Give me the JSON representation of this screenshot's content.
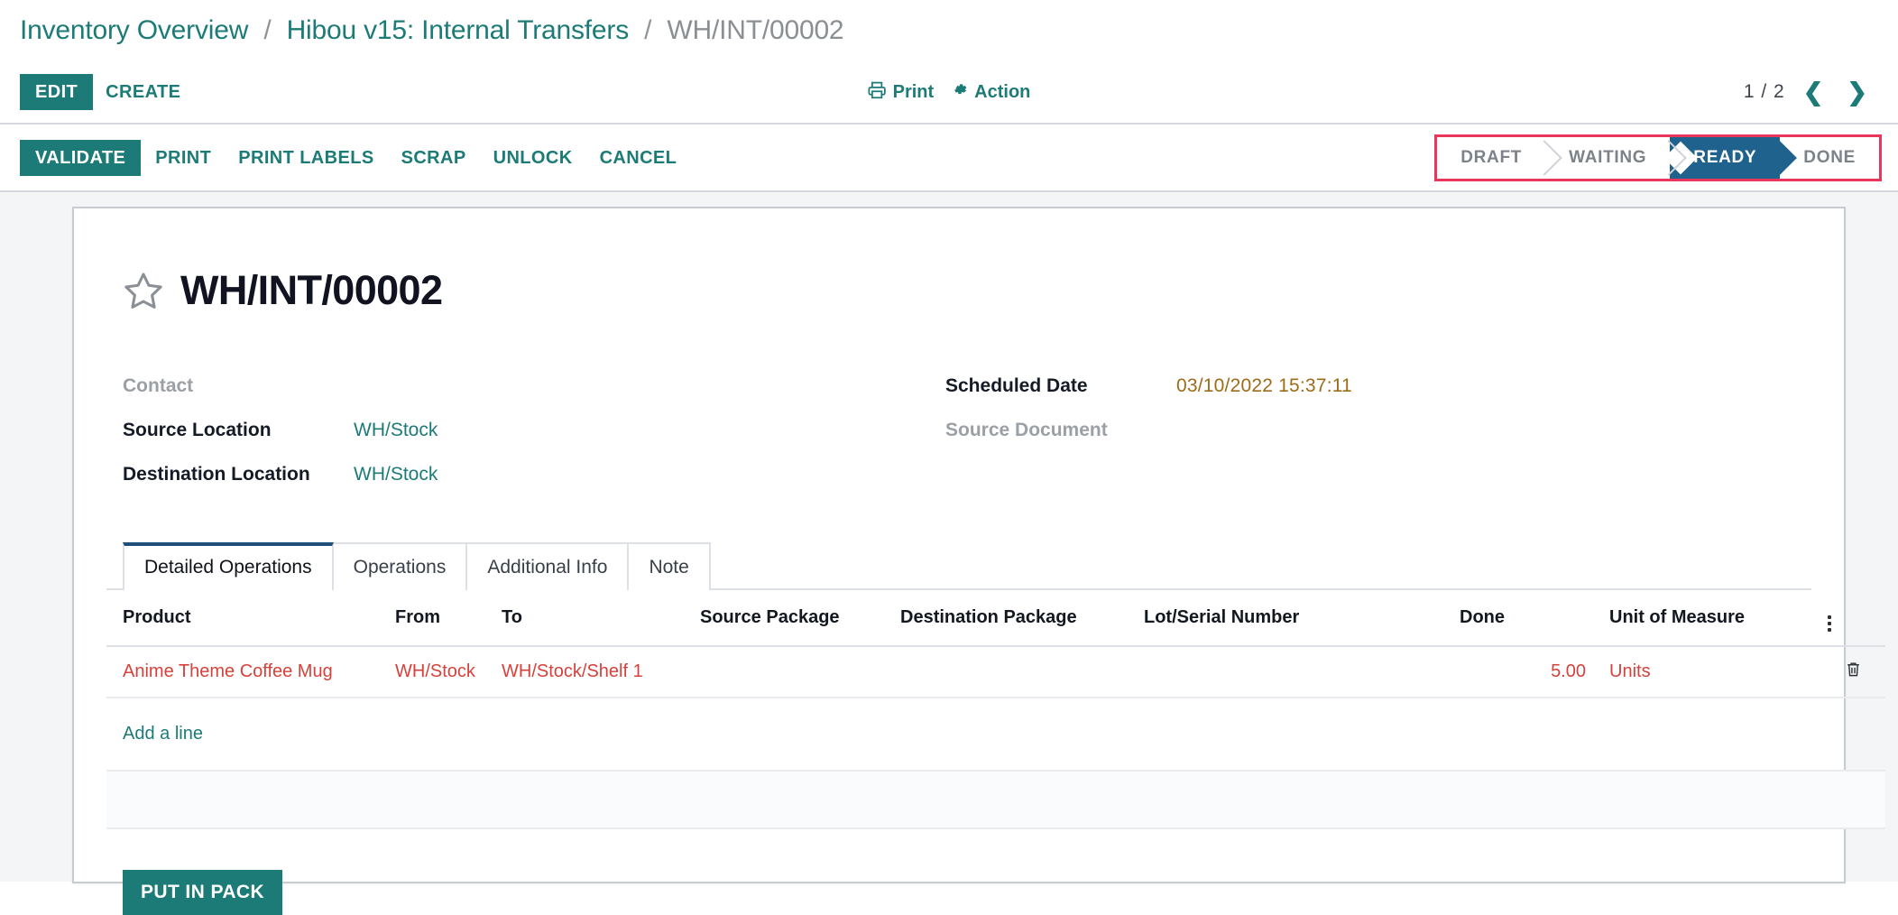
{
  "breadcrumb": {
    "items": [
      {
        "label": "Inventory Overview",
        "type": "link"
      },
      {
        "label": "Hibou v15: Internal Transfers",
        "type": "link"
      },
      {
        "label": "WH/INT/00002",
        "type": "current"
      }
    ],
    "separator": "/"
  },
  "control_panel": {
    "edit_label": "EDIT",
    "create_label": "CREATE",
    "print_label": "Print",
    "action_label": "Action",
    "pager_value": "1 / 2",
    "prev_icon": "chevron-left-icon",
    "next_icon": "chevron-right-icon"
  },
  "statusbar_row": {
    "buttons": [
      {
        "label": "VALIDATE",
        "style": "primary"
      },
      {
        "label": "PRINT",
        "style": "link"
      },
      {
        "label": "PRINT LABELS",
        "style": "link"
      },
      {
        "label": "SCRAP",
        "style": "link"
      },
      {
        "label": "UNLOCK",
        "style": "link"
      },
      {
        "label": "CANCEL",
        "style": "link"
      }
    ],
    "stages": [
      {
        "label": "DRAFT",
        "active": false
      },
      {
        "label": "WAITING",
        "active": false
      },
      {
        "label": "READY",
        "active": true
      },
      {
        "label": "DONE",
        "active": false
      }
    ],
    "highlight_color": "#e8365d",
    "active_stage_color": "#1f628e"
  },
  "record": {
    "favorite_icon": "star-outline-icon",
    "title": "WH/INT/00002",
    "fields_left": [
      {
        "label": "Contact",
        "value": "",
        "empty": true
      },
      {
        "label": "Source Location",
        "value": "WH/Stock",
        "empty": false
      },
      {
        "label": "Destination Location",
        "value": "WH/Stock",
        "empty": false
      }
    ],
    "fields_right": [
      {
        "label": "Scheduled Date",
        "value": "03/10/2022 15:37:11",
        "empty": false,
        "warn": true
      },
      {
        "label": "Source Document",
        "value": "",
        "empty": true
      }
    ]
  },
  "notebook": {
    "tabs": [
      {
        "label": "Detailed Operations",
        "active": true
      },
      {
        "label": "Operations",
        "active": false
      },
      {
        "label": "Additional Info",
        "active": false
      },
      {
        "label": "Note",
        "active": false
      }
    ]
  },
  "operations_table": {
    "columns": [
      "Product",
      "From",
      "To",
      "Source Package",
      "Destination Package",
      "Lot/Serial Number",
      "Done",
      "Unit of Measure"
    ],
    "optional_columns_icon": "kebab-menu-icon",
    "rows": [
      {
        "product": "Anime Theme Coffee Mug",
        "from": "WH/Stock",
        "to": "WH/Stock/Shelf 1",
        "source_package": "",
        "destination_package": "",
        "lot_serial": "",
        "done": "5.00",
        "uom": "Units",
        "delete_icon": "trash-icon"
      }
    ],
    "add_line_label": "Add a line",
    "row_text_color": "#d6413b"
  },
  "footer": {
    "put_in_pack_label": "PUT IN PACK"
  },
  "theme": {
    "accent": "#1d7b77",
    "page_bg": "#f4f5f7"
  }
}
